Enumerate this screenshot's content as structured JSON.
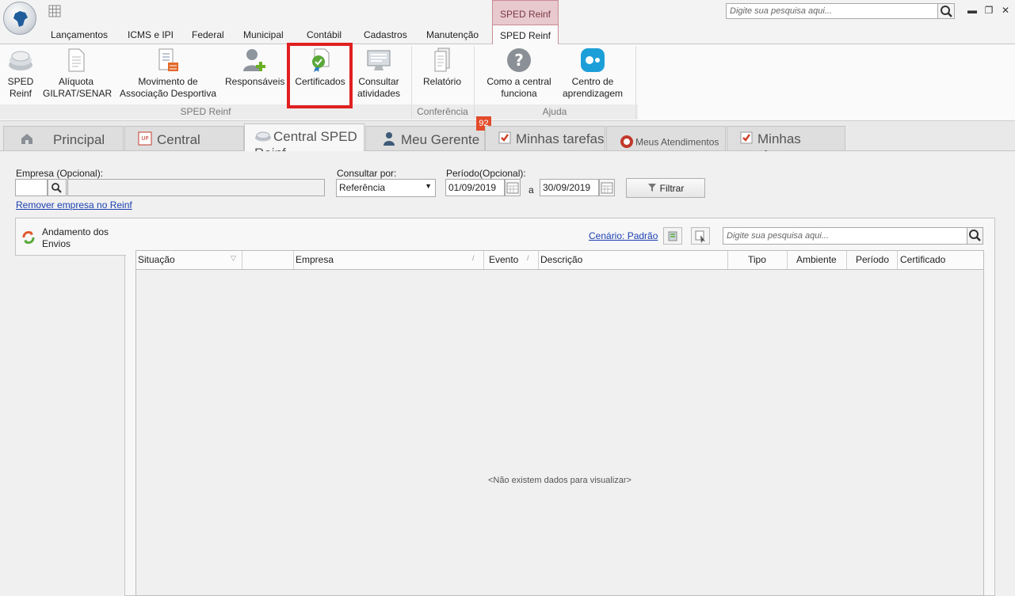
{
  "title_bar": {
    "context_tab": "SPED Reinf",
    "search_placeholder": "Digite sua pesquisa aqui..."
  },
  "menu": {
    "tabs": [
      "Lançamentos",
      "ICMS e IPI",
      "Federal",
      "Municipal",
      "Contábil",
      "Cadastros",
      "Manutenção",
      "SPED Reinf"
    ],
    "active": "SPED Reinf"
  },
  "ribbon": {
    "buttons": [
      {
        "label1": "SPED",
        "label2": "Reinf",
        "icon": "sped-reinf-icon"
      },
      {
        "label1": "Alíquota",
        "label2": "GILRAT/SENAR",
        "icon": "document-icon"
      },
      {
        "label1": "Movimento de",
        "label2": "Associação Desportiva",
        "icon": "list-exchange-icon"
      },
      {
        "label1": "Responsáveis",
        "label2": "",
        "icon": "user-add-icon"
      },
      {
        "label1": "Certificados",
        "label2": "",
        "icon": "certificate-icon"
      },
      {
        "label1": "Consultar",
        "label2": "atividades",
        "icon": "monitor-icon"
      },
      {
        "label1": "Relatório",
        "label2": "",
        "icon": "report-icon"
      },
      {
        "label1": "Como a central",
        "label2": "funciona",
        "icon": "help-icon"
      },
      {
        "label1": "Centro de",
        "label2": "aprendizagem",
        "icon": "learning-icon"
      }
    ],
    "groups": [
      "SPED Reinf",
      "Conferência",
      "Ajuda"
    ]
  },
  "doc_tabs": {
    "tabs": [
      "Principal",
      "Central PackUp",
      "Central SPED Reinf",
      "Meu Gerente",
      "Minhas tarefas",
      "Meus Atendimentos",
      "Minhas tarefas"
    ],
    "active": "Central SPED Reinf",
    "badge": "92"
  },
  "form": {
    "empresa_label": "Empresa (Opcional):",
    "empresa_value": "",
    "remover_link": "Remover empresa no Reinf",
    "consultar_label": "Consultar por:",
    "consultar_value": "Referência",
    "periodo_label": "Período(Opcional):",
    "date_from": "01/09/2019",
    "date_sep": "a",
    "date_to": "30/09/2019",
    "filtrar": "Filtrar"
  },
  "side": {
    "label1": "Andamento dos",
    "label2": "Envios"
  },
  "grid": {
    "cenario_link": "Cenário: Padrão",
    "search_placeholder": "Digite sua pesquisa aqui...",
    "columns": [
      "Situação",
      "",
      "Empresa",
      "Evento",
      "Descrição",
      "Tipo",
      "Ambiente",
      "Período",
      "Certificado"
    ],
    "empty_text": "<Não existem dados para visualizar>"
  },
  "colors": {
    "highlight": "#e02020",
    "link": "#1a3fb0",
    "badge": "#e24b2b",
    "context_tab": "#e8c9cd"
  }
}
